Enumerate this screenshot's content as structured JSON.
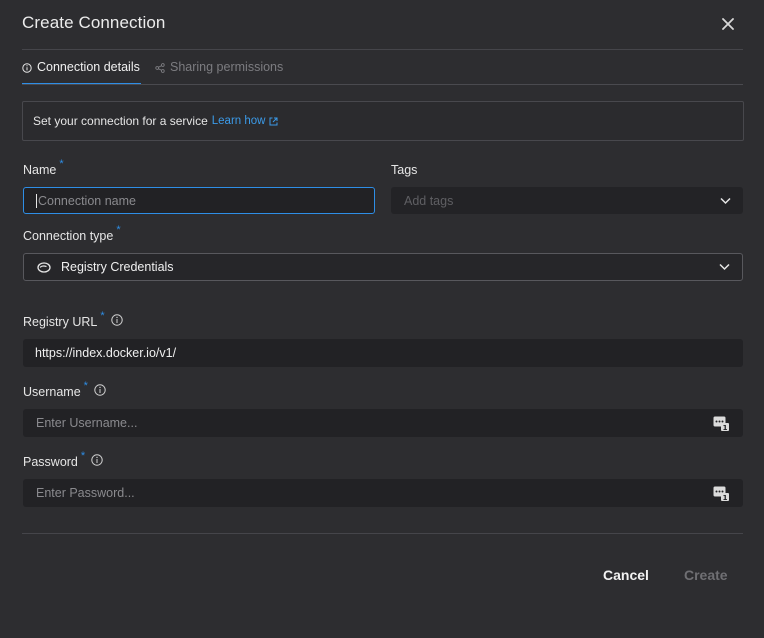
{
  "dialog": {
    "title": "Create Connection"
  },
  "tabs": [
    {
      "label": "Connection details",
      "icon": "info-icon",
      "active": true
    },
    {
      "label": "Sharing permissions",
      "icon": "share-icon",
      "active": false
    }
  ],
  "info": {
    "text": "Set your connection for a service",
    "link": "Learn how"
  },
  "form": {
    "name": {
      "label": "Name",
      "required": "*",
      "placeholder": "Connection name",
      "value": ""
    },
    "tags": {
      "label": "Tags",
      "placeholder": "Add tags"
    },
    "connection_type": {
      "label": "Connection type",
      "required": "*",
      "value": "Registry Credentials",
      "icon": "registry-icon"
    },
    "registry_url": {
      "label": "Registry URL",
      "required": "*",
      "value": "https://index.docker.io/v1/"
    },
    "username": {
      "label": "Username",
      "required": "*",
      "placeholder": "Enter Username..."
    },
    "password": {
      "label": "Password",
      "required": "*",
      "placeholder": "Enter Password..."
    }
  },
  "footer": {
    "cancel": "Cancel",
    "create": "Create"
  },
  "colors": {
    "accent": "#2e8ee6",
    "background": "#2d2d30",
    "input_bg": "#222225",
    "link": "#3b9ae8"
  }
}
